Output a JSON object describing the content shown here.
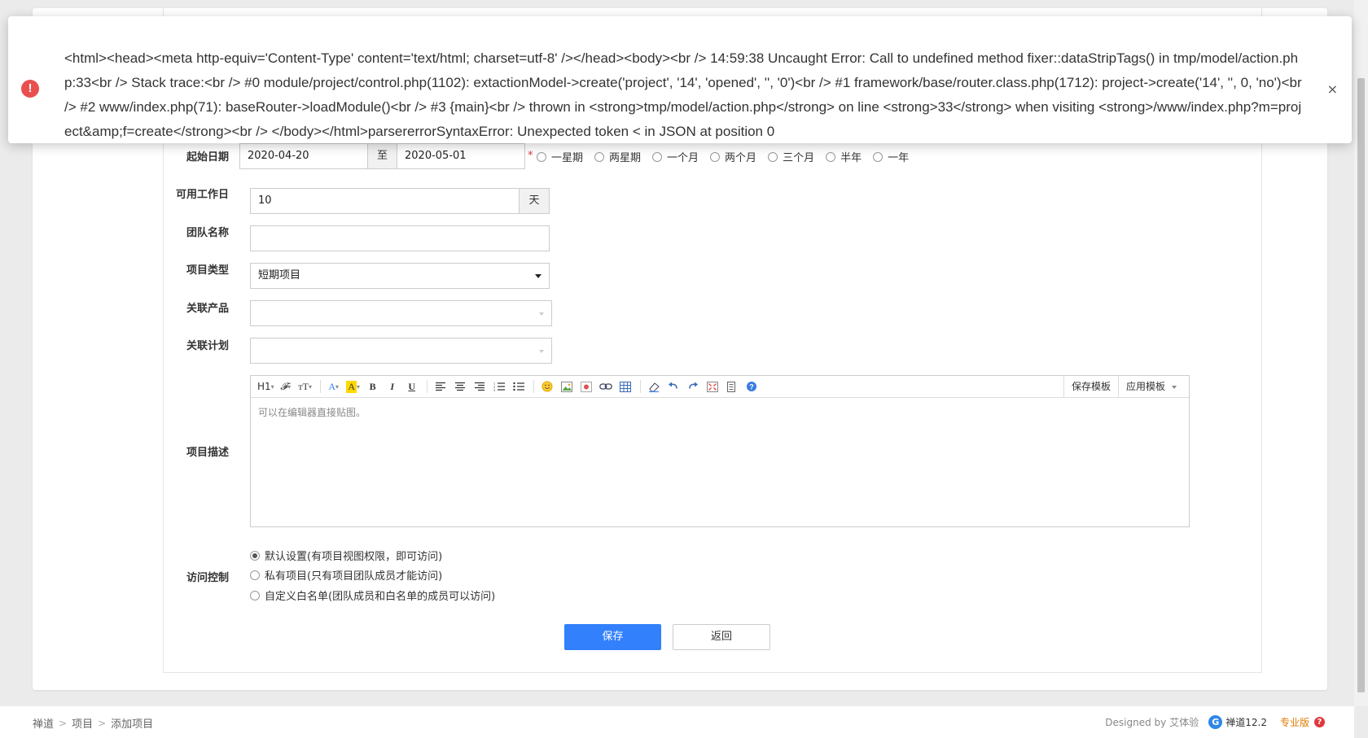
{
  "alert": {
    "message": "<html><head><meta http-equiv='Content-Type' content='text/html; charset=utf-8' /></head><body><br /> 14:59:38 Uncaught Error: Call to undefined method fixer::dataStripTags() in tmp/model/action.php:33<br /> Stack trace:<br /> #0 module/project/control.php(1102): extactionModel->create('project', '14', 'opened', '', '0')<br /> #1 framework/base/router.class.php(1712): project->create('14', '', 0, 'no')<br /> #2 www/index.php(71): baseRouter->loadModule()<br /> #3 {main}<br /> thrown in <strong>tmp/model/action.php</strong> on line <strong>33</strong> when visiting <strong>/www/index.php?m=project&amp;f=create</strong><br /> </body></html>parsererrorSyntaxError: Unexpected token < in JSON at position 0",
    "icon": "!",
    "close": "×"
  },
  "form": {
    "date": {
      "label": "起始日期",
      "begin": "2020-04-20",
      "to": "至",
      "end": "2020-05-01",
      "required": "*",
      "quick": [
        "一星期",
        "两星期",
        "一个月",
        "两个月",
        "三个月",
        "半年",
        "一年"
      ]
    },
    "days": {
      "label": "可用工作日",
      "value": "10",
      "unit": "天"
    },
    "team": {
      "label": "团队名称",
      "value": ""
    },
    "type": {
      "label": "项目类型",
      "value": "短期项目"
    },
    "products": {
      "label": "关联产品"
    },
    "plans": {
      "label": "关联计划"
    },
    "desc": {
      "label": "项目描述",
      "placeholder": "可以在编辑器直接贴图。",
      "toolbar": {
        "heading": "H1",
        "font": "𝓕",
        "size": "тT",
        "fontcolor": "A",
        "bgcolor": "A",
        "bold": "B",
        "italic": "I",
        "underline": "U",
        "save_template": "保存模板",
        "apply_template": "应用模板"
      }
    },
    "acl": {
      "label": "访问控制",
      "options": [
        "默认设置(有项目视图权限，即可访问)",
        "私有项目(只有项目团队成员才能访问)",
        "自定义白名单(团队成员和白名单的成员可以访问)"
      ]
    },
    "save": "保存",
    "back": "返回"
  },
  "footer": {
    "crumbs": [
      "禅道",
      "项目",
      "添加项目"
    ],
    "sep": ">",
    "designed_by": "Designed by",
    "designer": "艾体验",
    "logo": "G",
    "brand": "禅道12.2",
    "edition": "专业版",
    "help": "?"
  },
  "colors": {
    "primary": "#3280fc",
    "danger": "#ea4f4f",
    "edition": "#e07b00"
  }
}
